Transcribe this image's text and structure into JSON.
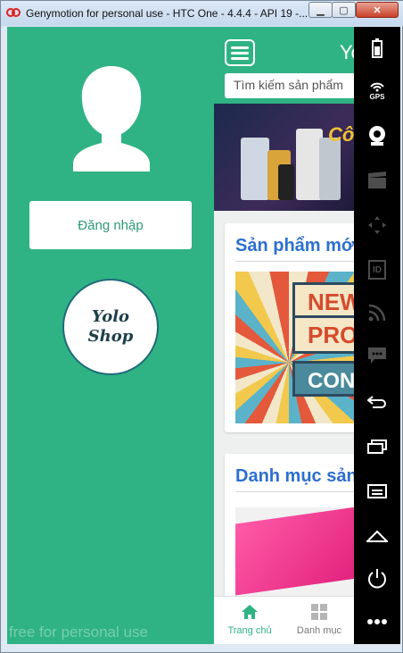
{
  "window": {
    "title": "Genymotion for personal use - HTC One - 4.4.4 - API 19 -...",
    "controls": {
      "minimize": "▁",
      "maximize": "▢",
      "close": "✕"
    }
  },
  "app": {
    "title": "Yo",
    "search_placeholder": "Tìm kiếm sản phẩm",
    "banner_text": "Cô",
    "sections": [
      {
        "title": "Sản phẩm mớ",
        "image_words": [
          "NEW",
          "PRO",
          "CON"
        ]
      },
      {
        "title": "Danh mục sản"
      }
    ],
    "bottom_nav": [
      {
        "label": "Trang chủ",
        "icon": "home-icon",
        "active": true
      },
      {
        "label": "Danh mục",
        "icon": "grid-icon",
        "active": false
      }
    ]
  },
  "drawer": {
    "login_label": "Đăng nhập",
    "logo_line1": "Yolo",
    "logo_line2": "Shop",
    "watermark": "free for personal use"
  },
  "toolbar": {
    "gps_label": "GPS",
    "id_label": "ID",
    "tools": [
      "battery-icon",
      "gps-icon",
      "webcam-icon",
      "clapper-icon",
      "move-icon",
      "id-icon",
      "rss-icon",
      "chat-icon",
      "back-icon",
      "recent-apps-icon",
      "menu-icon",
      "home-icon",
      "power-icon",
      "more-icon"
    ]
  },
  "colors": {
    "accent": "#2fb384",
    "title_blue": "#2c6fcf",
    "toolbar": "#000000"
  }
}
